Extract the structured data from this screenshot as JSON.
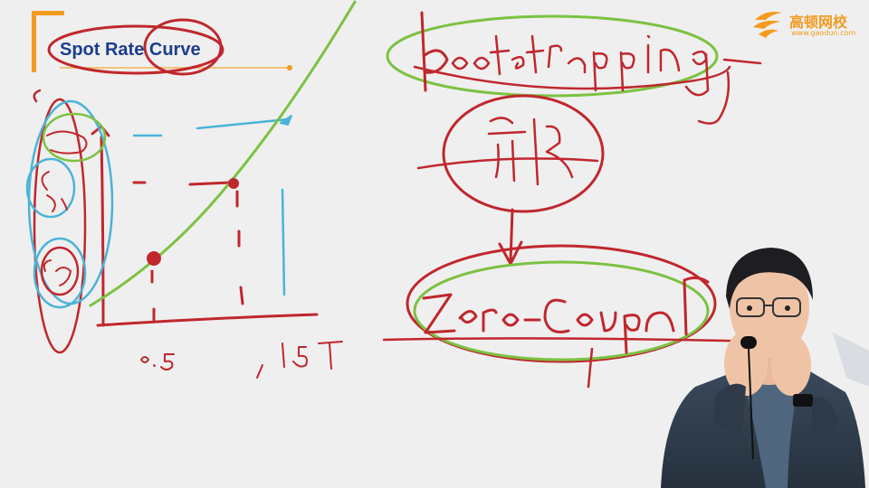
{
  "slide": {
    "title": "Spot Rate Curve"
  },
  "logo": {
    "name": "高顿网校",
    "url": "www.gaodun.com"
  },
  "colors": {
    "background": "#efefef",
    "title_text": "#1b3d8c",
    "accent_orange": "#f39b1f",
    "ink_red": "#c0272d",
    "ink_green": "#7cc242",
    "ink_blue": "#4bb3d8"
  },
  "handwriting": {
    "axis_ticks": [
      "0.5",
      "1",
      "1.5T"
    ],
    "spot_rates": [
      "S0.5",
      "S1",
      "S1.5"
    ],
    "method": "bootstrapping",
    "result": "Zero-coupon bond"
  }
}
